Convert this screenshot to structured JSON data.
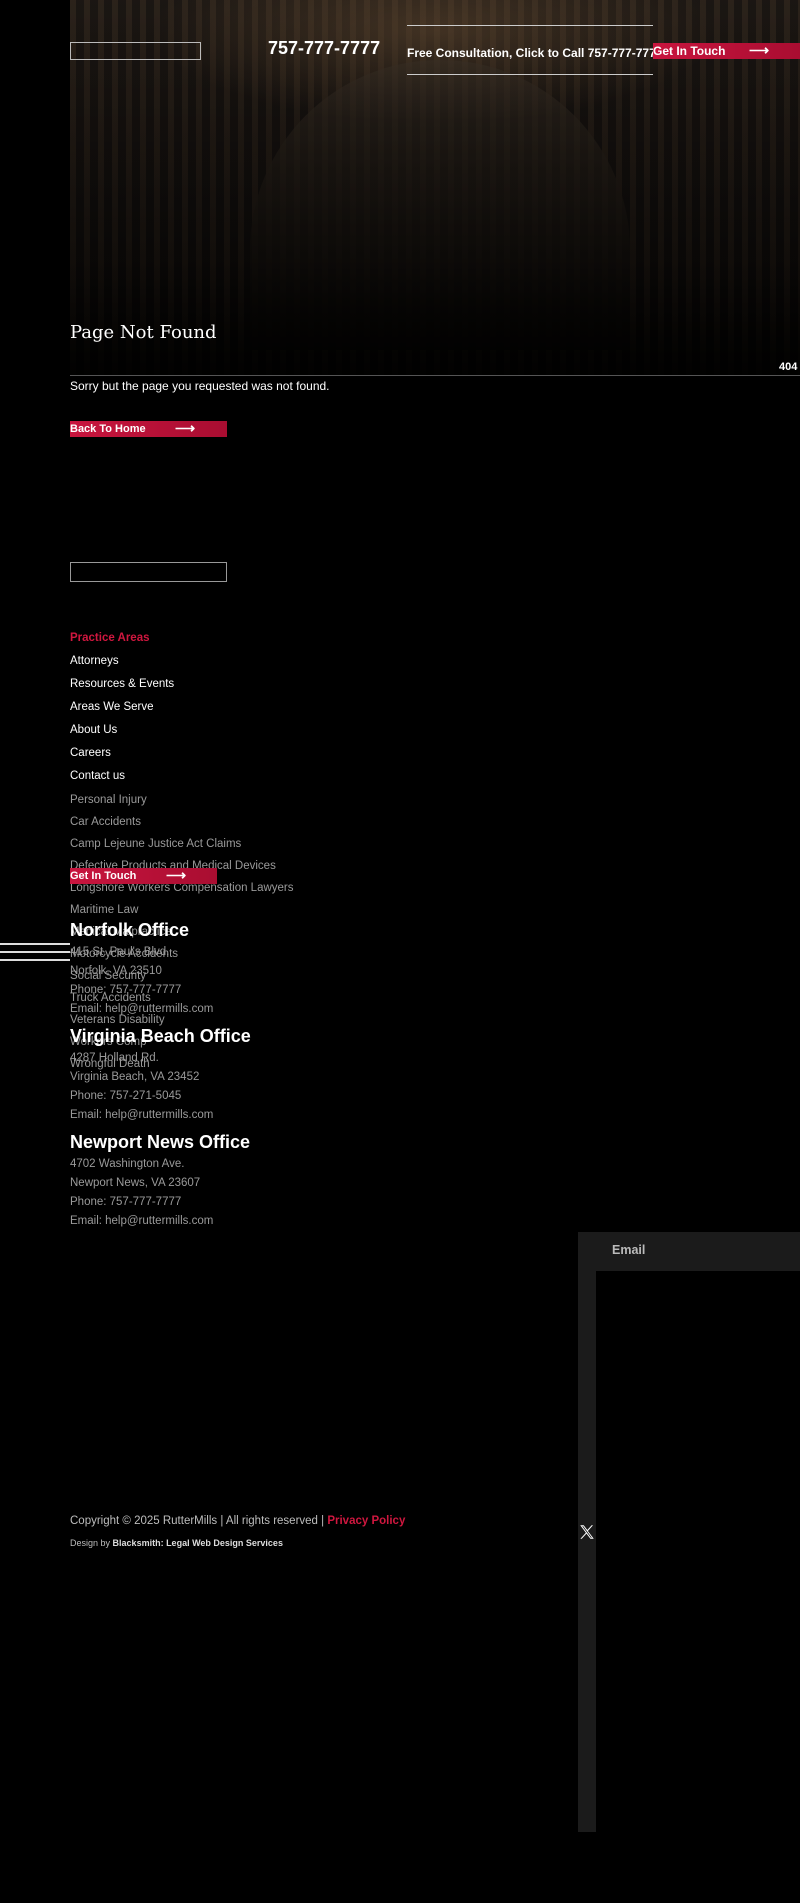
{
  "header": {
    "phone": "757-777-7777",
    "consultation": "Free Consultation, Click to Call 757-777-7777",
    "cta_label": "Get In Touch",
    "arrow": "⟶"
  },
  "main": {
    "title": "Page Not Found",
    "error_code": "404",
    "message": "Sorry but the page you requested was not found.",
    "home_button": "Back To Home"
  },
  "footer": {
    "nav": [
      "Practice Areas",
      "Attorneys",
      "Resources & Events",
      "Areas We Serve",
      "About Us",
      "Careers",
      "Contact us"
    ],
    "practice_areas": [
      "Personal Injury",
      "Car Accidents",
      "Camp Lejeune Justice Act Claims",
      "Defective Products and Medical Devices",
      "Longshore Workers Compensation Lawyers",
      "Maritime Law",
      "Medical Malpractice",
      "Motorcycle Accidents",
      "Social Security",
      "Truck Accidents",
      "Veterans Disability",
      "Workers Comp",
      "Wrongful Death"
    ],
    "cta_label": "Get In Touch",
    "offices": [
      {
        "title": "Norfolk Office",
        "address": "415 St. Paul's Blvd.",
        "city": "Norfolk, VA 23510",
        "phone": "Phone: 757-777-7777",
        "email": "Email: help@ruttermills.com"
      },
      {
        "title": "Virginia Beach Office",
        "address": "4287 Holland Rd.",
        "city": "Virginia Beach, VA 23452",
        "phone": "Phone: 757-271-5045",
        "email": "Email: help@ruttermills.com"
      },
      {
        "title": "Newport News Office",
        "address": "4702 Washington Ave.",
        "city": "Newport News, VA 23607",
        "phone": "Phone: 757-777-7777",
        "email": "Email: help@ruttermills.com"
      }
    ],
    "email_label": "Email",
    "copyright": "Copyright © 2025 RutterMills | All rights reserved |",
    "privacy": "Privacy Policy",
    "design_prefix": "Design by",
    "design_credit": "Blacksmith: Legal Web Design Services"
  },
  "colors": {
    "accent": "#c8153e",
    "background": "#000000",
    "muted_text": "#9a9a9a"
  },
  "icons": {
    "social": "x-logo-icon",
    "arrow": "arrow-right-icon",
    "menu": "hamburger-icon"
  }
}
